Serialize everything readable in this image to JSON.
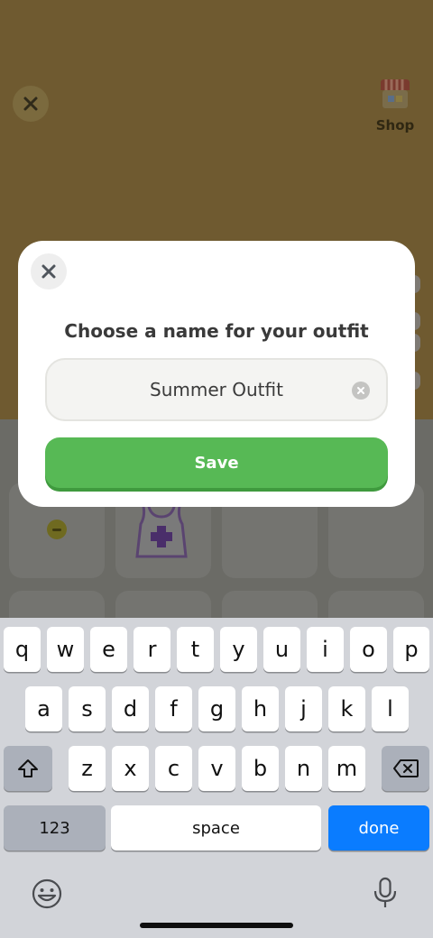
{
  "background": {
    "shop_label": "Shop"
  },
  "dialog": {
    "title": "Choose a name for your outfit",
    "name_value": "Summer Outfit",
    "save_label": "Save"
  },
  "keyboard": {
    "row1": [
      "q",
      "w",
      "e",
      "r",
      "t",
      "y",
      "u",
      "i",
      "o",
      "p"
    ],
    "row2": [
      "a",
      "s",
      "d",
      "f",
      "g",
      "h",
      "j",
      "k",
      "l"
    ],
    "row3": [
      "z",
      "x",
      "c",
      "v",
      "b",
      "n",
      "m"
    ],
    "numbers_label": "123",
    "space_label": "space",
    "done_label": "done"
  },
  "colors": {
    "save_green": "#57b955",
    "done_blue": "#0a7cff",
    "background_brown": "#6f5a30"
  }
}
